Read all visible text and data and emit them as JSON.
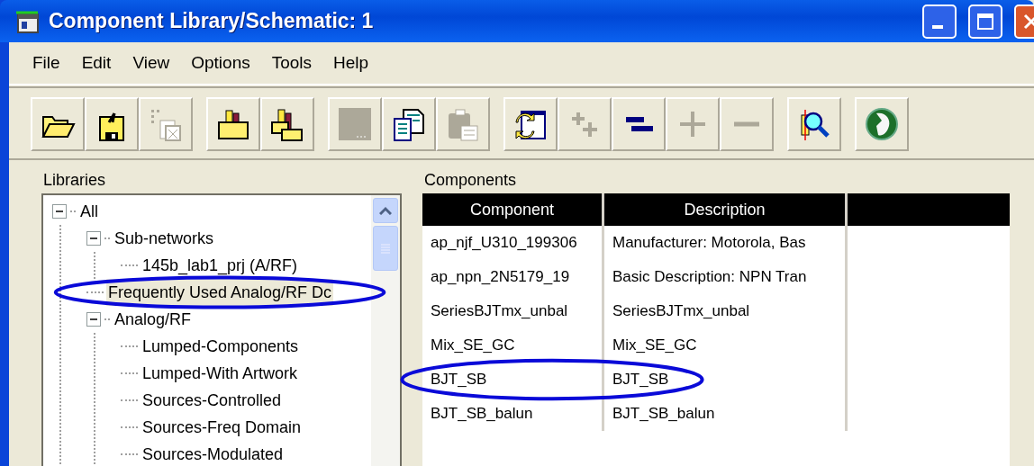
{
  "window": {
    "title": "Component Library/Schematic: 1"
  },
  "menu": [
    "File",
    "Edit",
    "View",
    "Options",
    "Tools",
    "Help"
  ],
  "toolbar": {
    "groups": [
      [
        {
          "kind": "open",
          "disabled": false
        },
        {
          "kind": "save",
          "disabled": false
        },
        {
          "kind": "window",
          "disabled": true
        }
      ],
      [
        {
          "kind": "folder-books",
          "disabled": false
        },
        {
          "kind": "books",
          "disabled": false
        }
      ],
      [
        {
          "kind": "blank",
          "disabled": true
        },
        {
          "kind": "copy",
          "disabled": false
        },
        {
          "kind": "paste",
          "disabled": true
        }
      ],
      [
        {
          "kind": "refresh",
          "disabled": false
        },
        {
          "kind": "add-all",
          "disabled": true
        },
        {
          "kind": "equals",
          "disabled": false
        },
        {
          "kind": "plus",
          "disabled": true
        },
        {
          "kind": "minus",
          "disabled": true
        }
      ],
      [
        {
          "kind": "search",
          "disabled": false
        }
      ],
      [
        {
          "kind": "globe",
          "disabled": false
        }
      ]
    ]
  },
  "libraries": {
    "label": "Libraries",
    "tree": [
      {
        "label": "All",
        "expanded": true,
        "selected": false,
        "circled": false,
        "children": [
          {
            "label": "Sub-networks",
            "expanded": true,
            "selected": false,
            "circled": false,
            "children": [
              {
                "label": "145b_lab1_prj (A/RF)",
                "selected": false,
                "circled": false
              }
            ]
          },
          {
            "label": "Frequently Used Analog/RF Dc",
            "selected": true,
            "circled": true
          },
          {
            "label": "Analog/RF",
            "expanded": true,
            "selected": false,
            "circled": false,
            "children": [
              {
                "label": "Lumped-Components",
                "selected": false,
                "circled": false
              },
              {
                "label": "Lumped-With Artwork",
                "selected": false,
                "circled": false
              },
              {
                "label": "Sources-Controlled",
                "selected": false,
                "circled": false
              },
              {
                "label": "Sources-Freq Domain",
                "selected": false,
                "circled": false
              },
              {
                "label": "Sources-Modulated",
                "selected": false,
                "circled": false
              }
            ]
          }
        ]
      }
    ]
  },
  "components": {
    "label": "Components",
    "columns": [
      "Component",
      "Description"
    ],
    "rows": [
      {
        "component": "ap_njf_U310_199306",
        "description": "Manufacturer: Motorola, Bas",
        "circled": false
      },
      {
        "component": "ap_npn_2N5179_19",
        "description": "Basic Description: NPN Tran",
        "circled": false
      },
      {
        "component": "SeriesBJTmx_unbal",
        "description": "SeriesBJTmx_unbal",
        "circled": false
      },
      {
        "component": "Mix_SE_GC",
        "description": "Mix_SE_GC",
        "circled": false
      },
      {
        "component": "BJT_SB",
        "description": "BJT_SB",
        "circled": true
      },
      {
        "component": "BJT_SB_balun",
        "description": "BJT_SB_balun",
        "circled": false
      }
    ]
  }
}
